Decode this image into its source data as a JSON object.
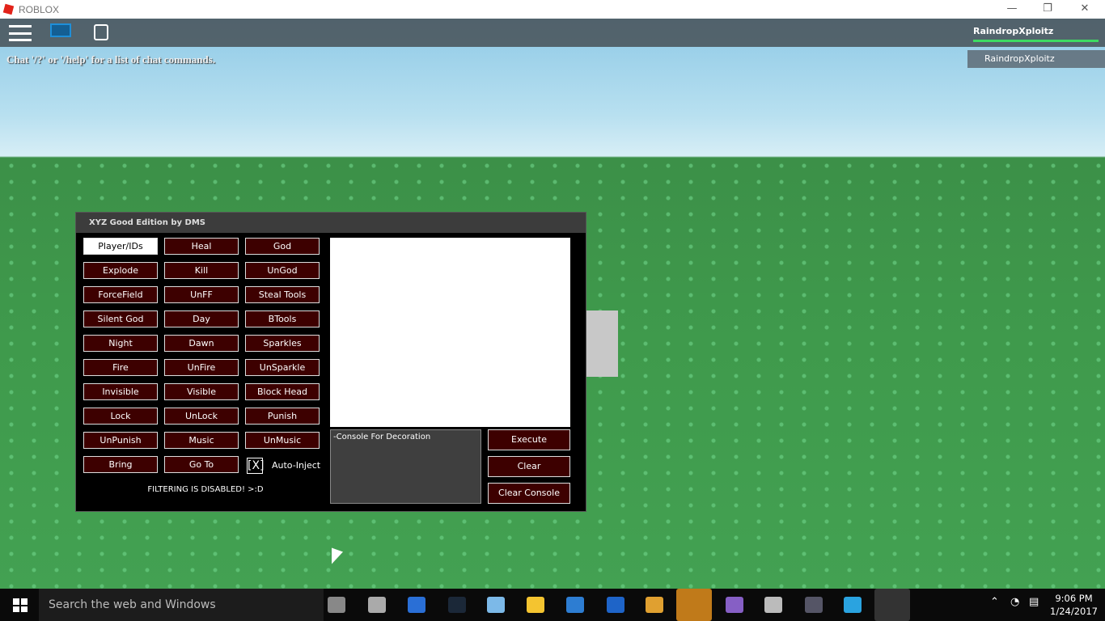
{
  "window": {
    "title": "ROBLOX",
    "minimize": "—",
    "restore": "❐",
    "close": "✕"
  },
  "game": {
    "chat_hint": "Chat '/?' or '/help' for a list of chat commands.",
    "player_name": "RaindropXploitz",
    "player_list": [
      "RaindropXploitz"
    ]
  },
  "panel": {
    "title": "XYZ Good Edition by DMS",
    "buttons": [
      [
        "Player/IDs",
        "Heal",
        "God"
      ],
      [
        "Explode",
        "Kill",
        "UnGod"
      ],
      [
        "ForceField",
        "UnFF",
        "Steal Tools"
      ],
      [
        "Silent God",
        "Day",
        "BTools"
      ],
      [
        "Night",
        "Dawn",
        "Sparkles"
      ],
      [
        "Fire",
        "UnFire",
        "UnSparkle"
      ],
      [
        "Invisible",
        "Visible",
        "Block Head"
      ],
      [
        "Lock",
        "UnLock",
        "Punish"
      ],
      [
        "UnPunish",
        "Music",
        "UnMusic"
      ],
      [
        "Bring",
        "Go To"
      ]
    ],
    "auto_inject_check": "[X]",
    "auto_inject_label": "Auto-Inject",
    "filtering": "FILTERING IS DISABLED! >:D",
    "console_text": "-Console For Decoration",
    "execute": "Execute",
    "clear": "Clear",
    "clear_console": "Clear Console",
    "accent": "#3d0000"
  },
  "taskbar": {
    "search_placeholder": "Search the web and Windows",
    "time": "9:06 PM",
    "date": "1/24/2017",
    "apps": [
      "task-view",
      "obs",
      "browser",
      "steam",
      "app",
      "file-explorer",
      "app",
      "app",
      "chrome",
      "discord",
      "visual-studio",
      "app",
      "app",
      "water-app",
      "roblox"
    ]
  }
}
